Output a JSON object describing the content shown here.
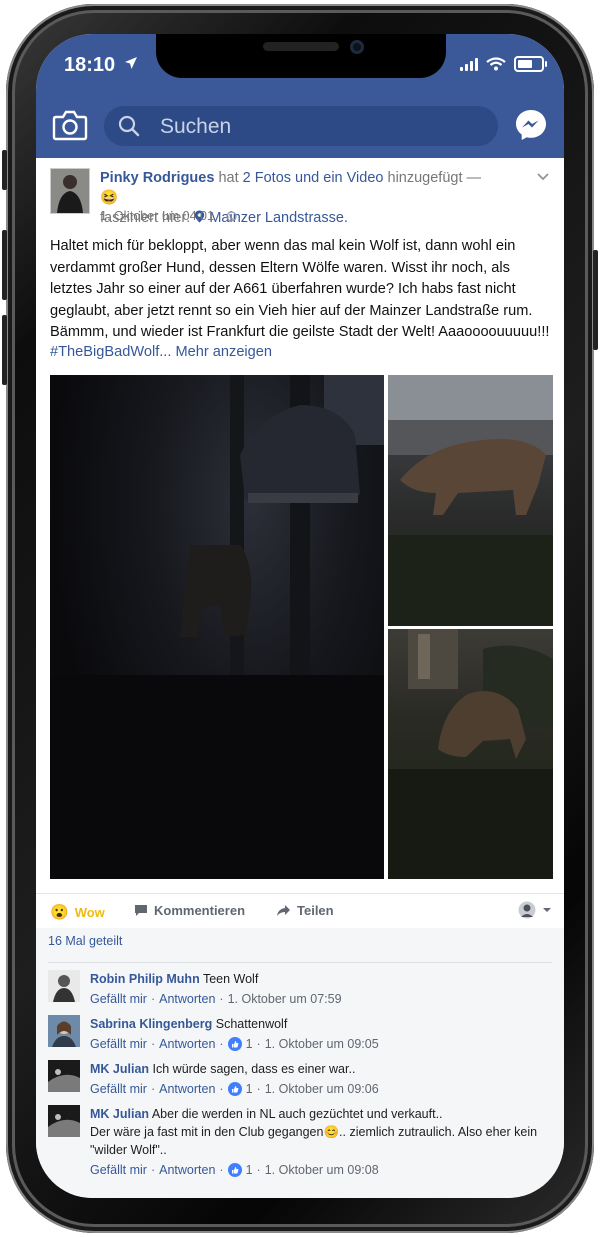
{
  "status_bar": {
    "time": "18:10"
  },
  "app_header": {
    "search_placeholder": "Suchen",
    "brand_color": "#3b5998"
  },
  "post": {
    "author": "Pinky Rodrigues",
    "action_text": "hat",
    "media_text": "2 Fotos und ein Video",
    "added_text": "hinzugefügt —",
    "feeling_text": "fasziniert hier:",
    "location": "Mainzer Landstrasse.",
    "timestamp": "1. Oktober um 04:01 ·",
    "body": "Haltet mich für bekloppt, aber wenn das mal kein Wolf ist, dann wohl ein verdammt großer Hund, dessen Eltern Wölfe waren. Wisst ihr noch, als letztes Jahr so einer auf der A661 überfahren wurde? Ich habs fast nicht geglaubt, aber jetzt rennt so ein Vieh hier auf der Mainzer Landstraße rum. Bämmm, und wieder ist Frankfurt die geilste Stadt der Welt! Aaaoooouuuuu!!!",
    "hashtag": "#TheBigBadWolf...",
    "more": "Mehr anzeigen",
    "photos": [
      {
        "icon": "photo-dark-street"
      },
      {
        "icon": "photo-wolf-running"
      },
      {
        "icon": "photo-wolf-grass"
      }
    ],
    "actions": {
      "wow": "Wow",
      "comment": "Kommentieren",
      "share": "Teilen"
    }
  },
  "comments_section": {
    "shares": "16 Mal geteilt",
    "like_label": "Gefällt mir",
    "reply_label": "Antworten",
    "items": [
      {
        "name": "Robin Philip Muhn",
        "text": "Teen Wolf",
        "likes": "",
        "time": "1. Oktober um 07:59"
      },
      {
        "name": "Sabrina Klingenberg",
        "text": "Schattenwolf",
        "likes": "1",
        "time": "1. Oktober um 09:05"
      },
      {
        "name": "MK Julian",
        "text": "Ich würde sagen, dass es einer war..",
        "likes": "1",
        "time": "1. Oktober um 09:06"
      },
      {
        "name": "MK Julian",
        "text": "Aber die werden in NL auch gezüchtet und verkauft..",
        "text2": "Der wäre ja fast mit in den Club gegangen",
        "text3": ".. ziemlich zutraulich. Also eher kein \"wilder Wolf\"..",
        "likes": "1",
        "time": "1. Oktober um 09:08"
      }
    ]
  }
}
